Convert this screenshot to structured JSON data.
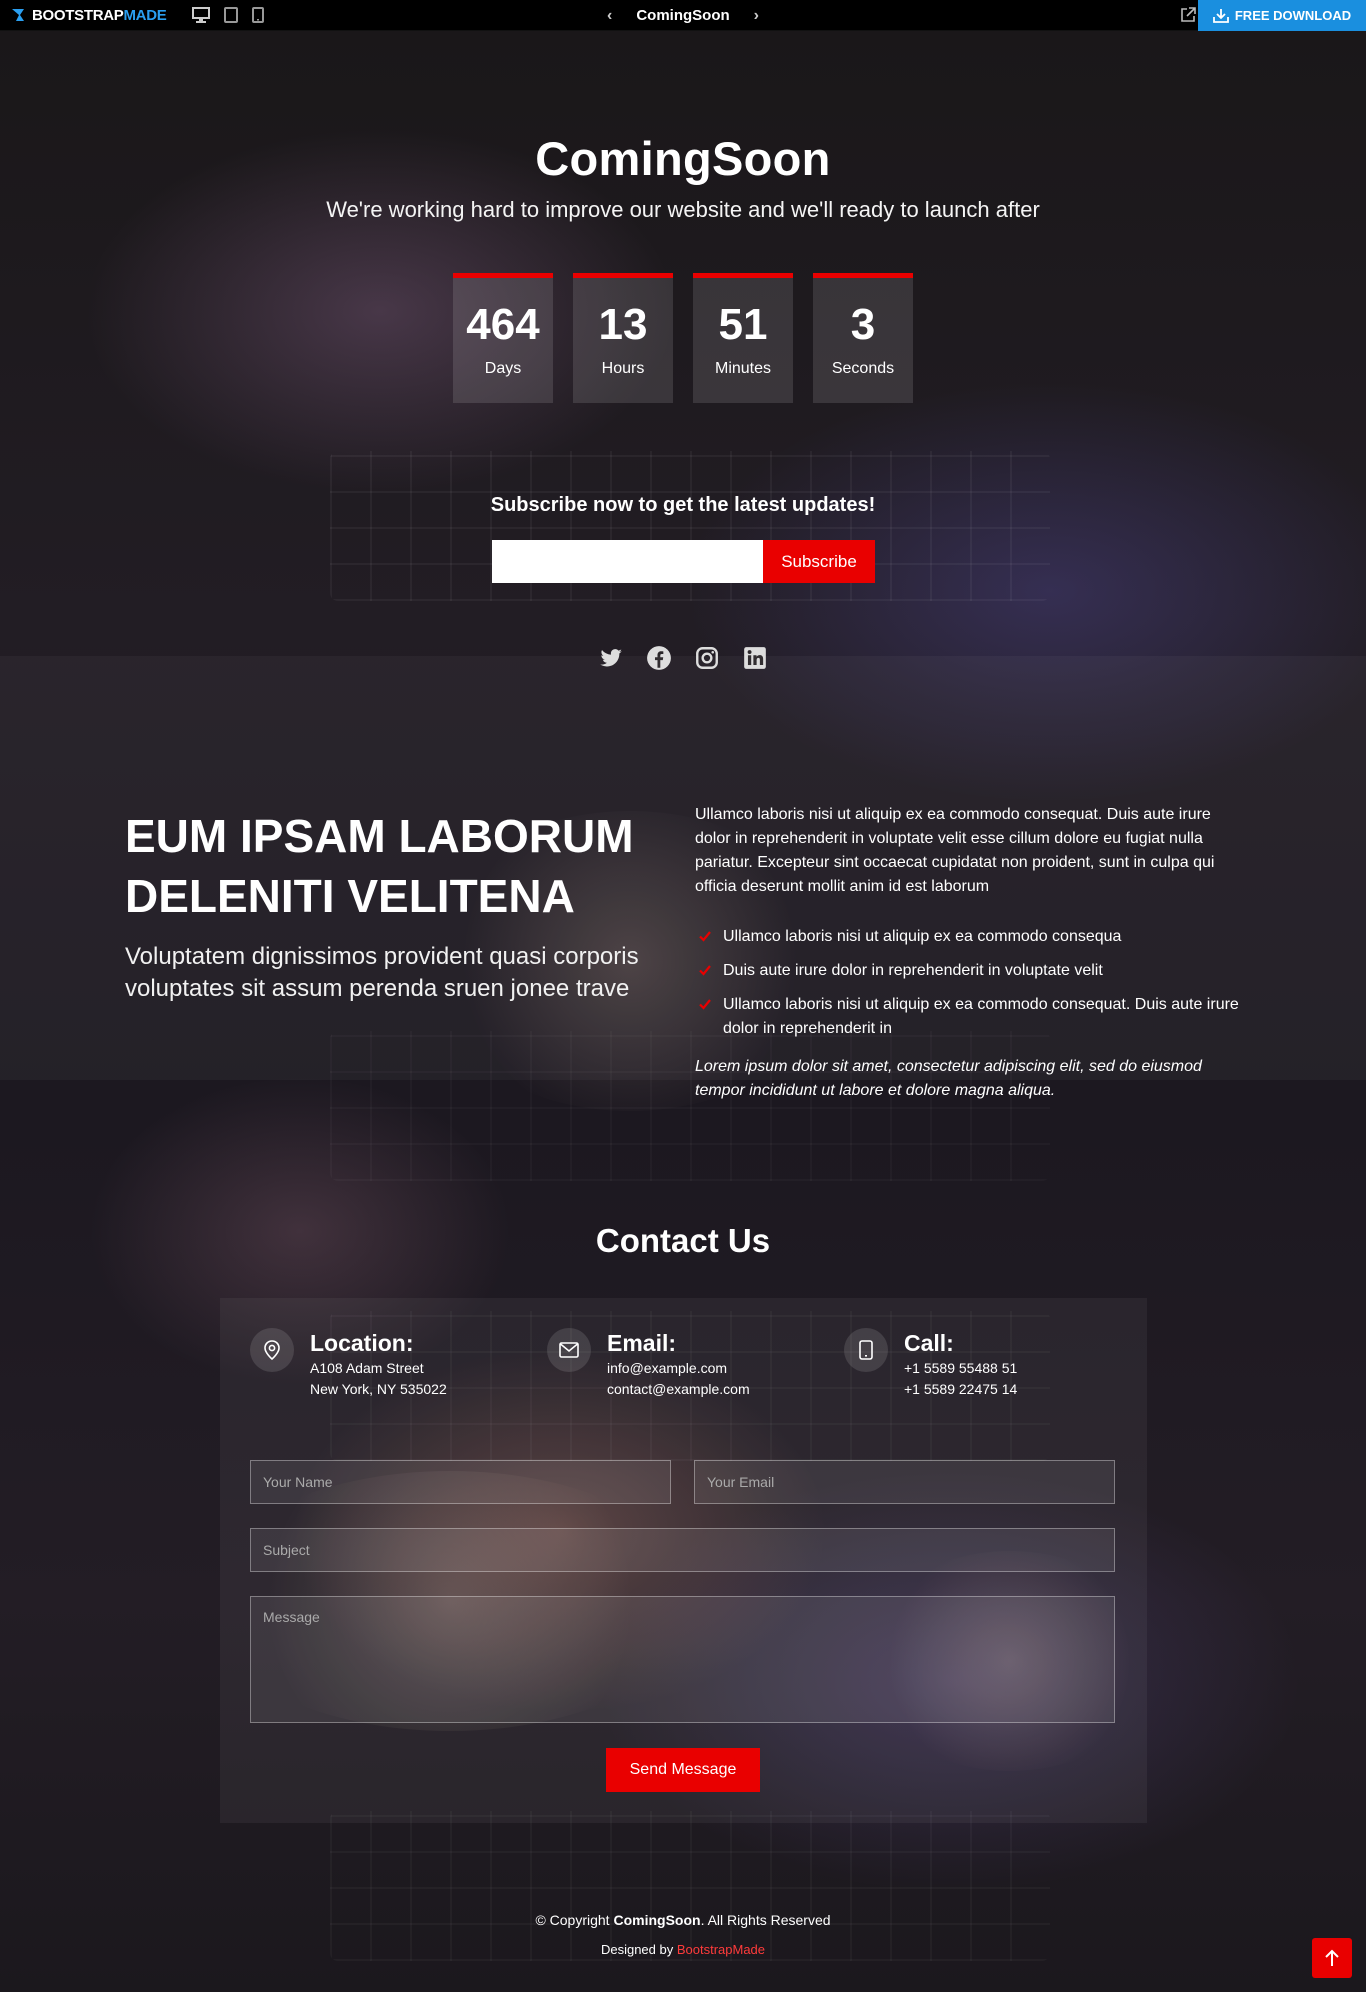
{
  "topbar": {
    "brand_part1": "BOOTSTRAP",
    "brand_part2": "MADE",
    "page_name": "ComingSoon",
    "download_label": "FREE DOWNLOAD",
    "prev_arrow": "‹",
    "next_arrow": "›"
  },
  "hero": {
    "title": "ComingSoon",
    "subtitle": "We're working hard to improve our website and we'll ready to launch after",
    "countdown": [
      {
        "value": "464",
        "label": "Days"
      },
      {
        "value": "13",
        "label": "Hours"
      },
      {
        "value": "51",
        "label": "Minutes"
      },
      {
        "value": "3",
        "label": "Seconds"
      }
    ],
    "subscribe_title": "Subscribe now to get the latest updates!",
    "subscribe_input_value": "",
    "subscribe_button": "Subscribe",
    "socials": [
      "twitter-icon",
      "facebook-icon",
      "instagram-icon",
      "linkedin-icon"
    ]
  },
  "about": {
    "title_line1": "EUM IPSAM LABORUM",
    "title_line2": "DELENITI VELITENA",
    "lead": "Voluptatem dignissimos provident quasi corporis voluptates sit assum perenda sruen jonee trave",
    "paragraph": "Ullamco laboris nisi ut aliquip ex ea commodo consequat. Duis aute irure dolor in reprehenderit in voluptate velit esse cillum dolore eu fugiat nulla pariatur. Excepteur sint occaecat cupidatat non proident, sunt in culpa qui officia deserunt mollit anim id est laborum",
    "items": [
      "Ullamco laboris nisi ut aliquip ex ea commodo consequa",
      "Duis aute irure dolor in reprehenderit in voluptate velit",
      "Ullamco laboris nisi ut aliquip ex ea commodo consequat. Duis aute irure dolor in reprehenderit in"
    ],
    "italic": "Lorem ipsum dolor sit amet, consectetur adipiscing elit, sed do eiusmod tempor incididunt ut labore et dolore magna aliqua."
  },
  "contact": {
    "title": "Contact Us",
    "location": {
      "heading": "Location:",
      "line1": "A108 Adam Street",
      "line2": "New York, NY 535022"
    },
    "email": {
      "heading": "Email:",
      "line1": "info@example.com",
      "line2": "contact@example.com"
    },
    "call": {
      "heading": "Call:",
      "line1": "+1 5589 55488 51",
      "line2": "+1 5589 22475 14"
    },
    "name_placeholder": "Your Name",
    "email_placeholder": "Your Email",
    "subject_placeholder": "Subject",
    "message_placeholder": "Message",
    "send_label": "Send Message"
  },
  "footer": {
    "copy_prefix": "© Copyright ",
    "copy_brand": "ComingSoon",
    "copy_suffix": ". All Rights Reserved",
    "designed_prefix": "Designed by ",
    "designed_link": "BootstrapMade"
  },
  "colors": {
    "accent": "#e90000",
    "download": "#1a8fdf",
    "brand_blue": "#2a9ff0"
  }
}
